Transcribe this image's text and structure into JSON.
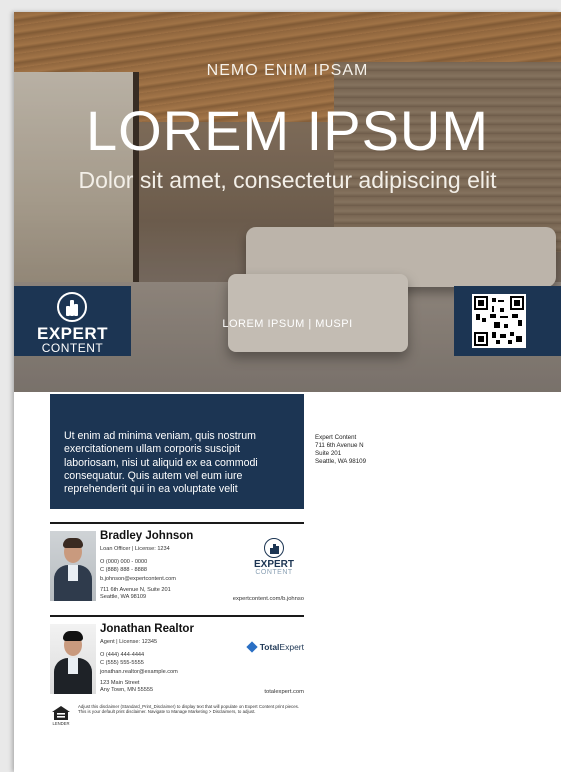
{
  "hero": {
    "kicker": "NEMO ENIM IPSAM",
    "title": "LOREM IPSUM",
    "subtitle": "Dolor sit amet, consectetur adipiscing elit",
    "tagline": "LOREM IPSUM | MUSPI"
  },
  "brand": {
    "logo_line1": "EXPERT",
    "logo_line2": "CONTENT",
    "navy": "#1c3553"
  },
  "info": {
    "paragraph": "Ut enim ad minima veniam, quis nostrum exercitationem ullam corporis suscipit laboriosam, nisi ut aliquid ex ea commodi consequatur. Quis autem vel eum iure reprehenderit qui in ea voluptate velit"
  },
  "address": {
    "line1": "Expert Content",
    "line2": "711 6th Avenue N",
    "line3": "Suite 201",
    "line4": "Seattle, WA 98109"
  },
  "agent1": {
    "name": "Bradley Johnson",
    "title": "Loan Officer | License: 1234",
    "phone_office": "O (000) 000 - 0000",
    "phone_cell": "C (888) 888 - 8888",
    "email": "b.johnson@expertcontent.com",
    "address1": "711 6th Avenue N, Suite 201",
    "address2": "Seattle, WA 98109",
    "url": "expertcontent.com/b.johnso",
    "logo_line1": "EXPERT",
    "logo_line2": "CONTENT"
  },
  "agent2": {
    "name": "Jonathan Realtor",
    "title": "Agent | License: 12345",
    "phone_office": "O (444) 444-4444",
    "phone_cell": "C (555) 555-5555",
    "email": "jonathan.realtor@example.com",
    "address1": "123 Main Street",
    "address2": "Any Town, MN 55555",
    "url": "totalexpert.com",
    "logo_total": "Total",
    "logo_expert": "Expert"
  },
  "footer": {
    "ehl_label": "LENDER",
    "disclaimer": "Adjust this disclaimer (Standard_Print_Disclaimer) to display text that will populate on Expert Content print pieces. This is your default print disclaimer. Navigate to Manage Marketing > Disclaimers, to adjust."
  }
}
